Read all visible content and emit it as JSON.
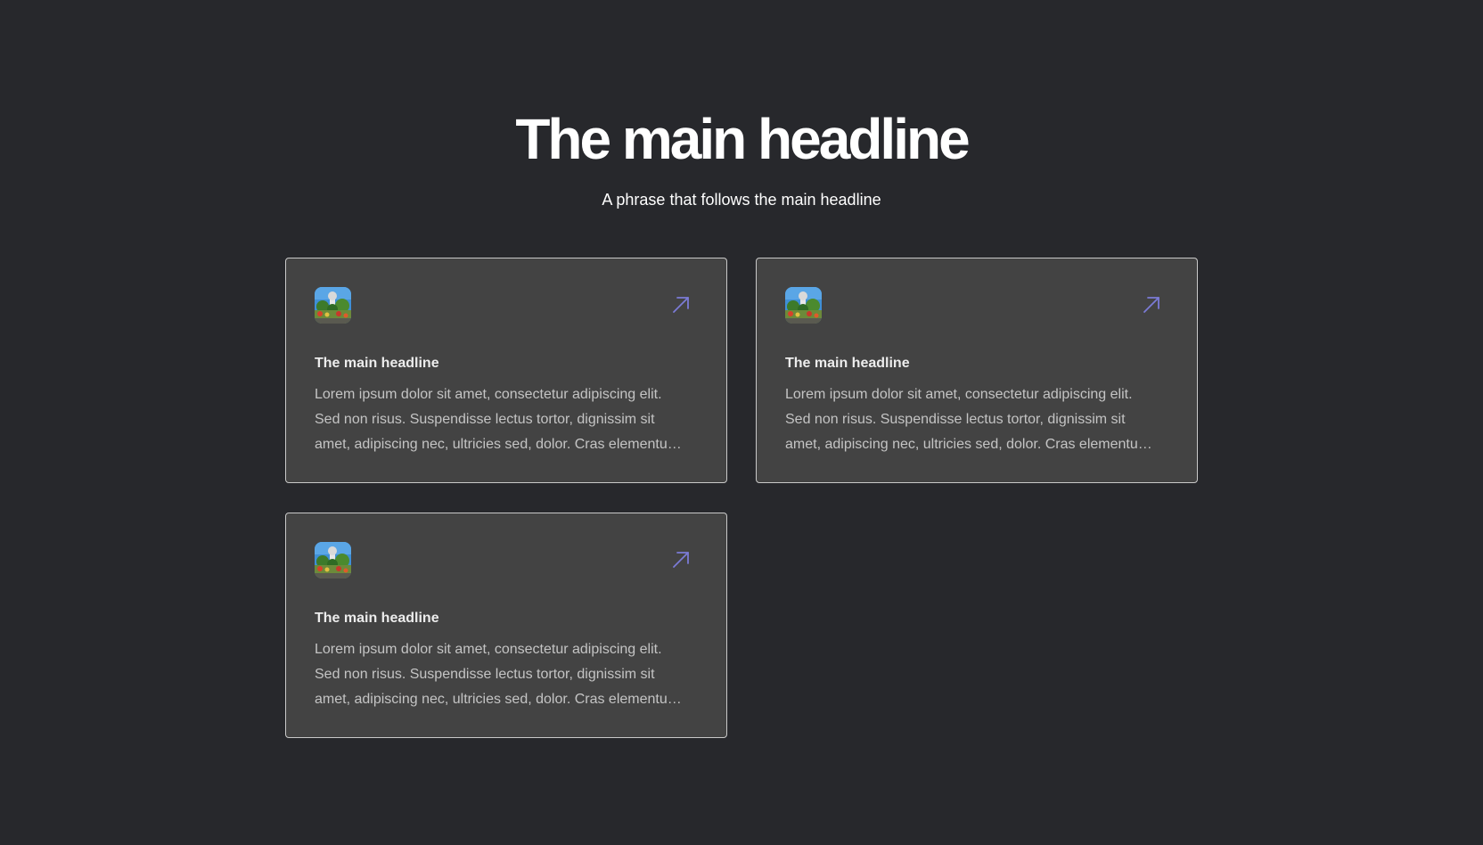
{
  "hero": {
    "title": "The main headline",
    "subtitle": "A phrase that follows the main headline"
  },
  "cards": [
    {
      "title": "The main headline",
      "body": "Lorem ipsum dolor sit amet, consectetur adipiscing elit. Sed non risus. Suspendisse lectus tortor, dignissim sit amet, adipiscing nec, ultricies sed, dolor. Cras elementum ultrices diam.",
      "icon": "arrow-up-right-icon"
    },
    {
      "title": "The main headline",
      "body": "Lorem ipsum dolor sit amet, consectetur adipiscing elit. Sed non risus. Suspendisse lectus tortor, dignissim sit amet, adipiscing nec, ultricies sed, dolor. Cras elementum ultrices diam.",
      "icon": "arrow-up-right-icon"
    },
    {
      "title": "The main headline",
      "body": "Lorem ipsum dolor sit amet, consectetur adipiscing elit. Sed non risus. Suspendisse lectus tortor, dignissim sit amet, adipiscing nec, ultricies sed, dolor. Cras elementum ultrices diam.",
      "icon": "arrow-up-right-icon"
    }
  ],
  "colors": {
    "background": "#27282c",
    "card_background": "#434343",
    "card_border": "#c9c9c9",
    "arrow_accent": "#7b7bd6"
  }
}
